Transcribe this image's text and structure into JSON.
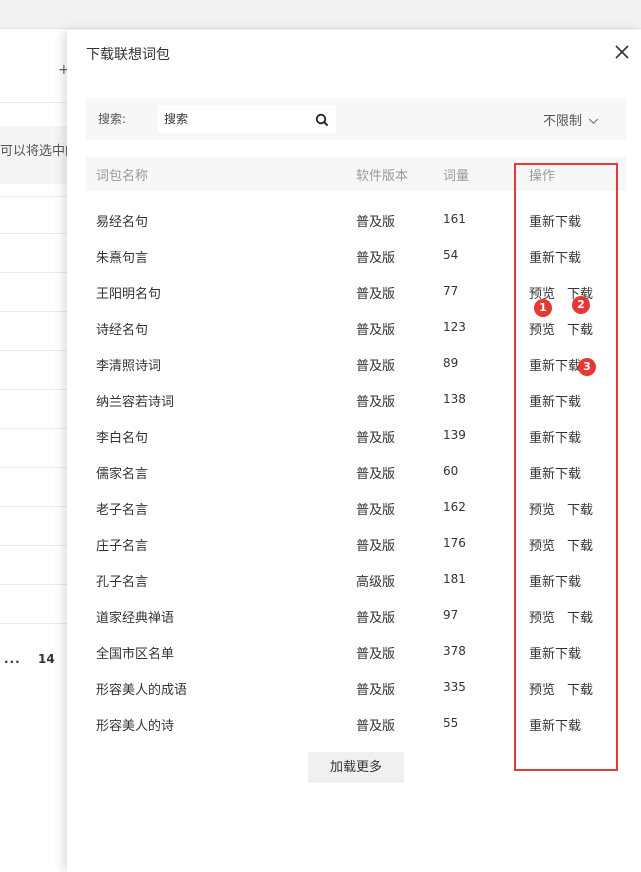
{
  "background": {
    "hint_text": "可以将选中的",
    "pager_dots": "...",
    "pager_number": "14"
  },
  "modal": {
    "title": "下载联想词包",
    "close_icon": "close-icon",
    "search": {
      "label": "搜索:",
      "placeholder": "搜索",
      "icon": "search-icon"
    },
    "filter": {
      "selected": "不限制",
      "icon": "chevron-down-icon"
    },
    "columns": {
      "name": "词包名称",
      "version": "软件版本",
      "count": "词量",
      "action": "操作"
    },
    "rows": [
      {
        "name": "易经名句",
        "version": "普及版",
        "count": "161",
        "actions": [
          "重新下载"
        ]
      },
      {
        "name": "朱熹句言",
        "version": "普及版",
        "count": "54",
        "actions": [
          "重新下载"
        ]
      },
      {
        "name": "王阳明名句",
        "version": "普及版",
        "count": "77",
        "actions": [
          "预览",
          "下载"
        ]
      },
      {
        "name": "诗经名句",
        "version": "普及版",
        "count": "123",
        "actions": [
          "预览",
          "下载"
        ]
      },
      {
        "name": "李清照诗词",
        "version": "普及版",
        "count": "89",
        "actions": [
          "重新下载"
        ]
      },
      {
        "name": "纳兰容若诗词",
        "version": "普及版",
        "count": "138",
        "actions": [
          "重新下载"
        ]
      },
      {
        "name": "李白名句",
        "version": "普及版",
        "count": "139",
        "actions": [
          "重新下载"
        ]
      },
      {
        "name": "儒家名言",
        "version": "普及版",
        "count": "60",
        "actions": [
          "重新下载"
        ]
      },
      {
        "name": "老子名言",
        "version": "普及版",
        "count": "162",
        "actions": [
          "预览",
          "下载"
        ]
      },
      {
        "name": "庄子名言",
        "version": "普及版",
        "count": "176",
        "actions": [
          "预览",
          "下载"
        ]
      },
      {
        "name": "孔子名言",
        "version": "高级版",
        "count": "181",
        "actions": [
          "重新下载"
        ]
      },
      {
        "name": "道家经典禅语",
        "version": "普及版",
        "count": "97",
        "actions": [
          "预览",
          "下载"
        ]
      },
      {
        "name": "全国市区名单",
        "version": "普及版",
        "count": "378",
        "actions": [
          "重新下载"
        ]
      },
      {
        "name": "形容美人的成语",
        "version": "普及版",
        "count": "335",
        "actions": [
          "预览",
          "下载"
        ]
      },
      {
        "name": "形容美人的诗",
        "version": "普及版",
        "count": "55",
        "actions": [
          "重新下载"
        ]
      }
    ],
    "load_more": "加载更多"
  },
  "annotations": {
    "color": "#e53935",
    "markers": [
      "1",
      "2",
      "3"
    ]
  }
}
